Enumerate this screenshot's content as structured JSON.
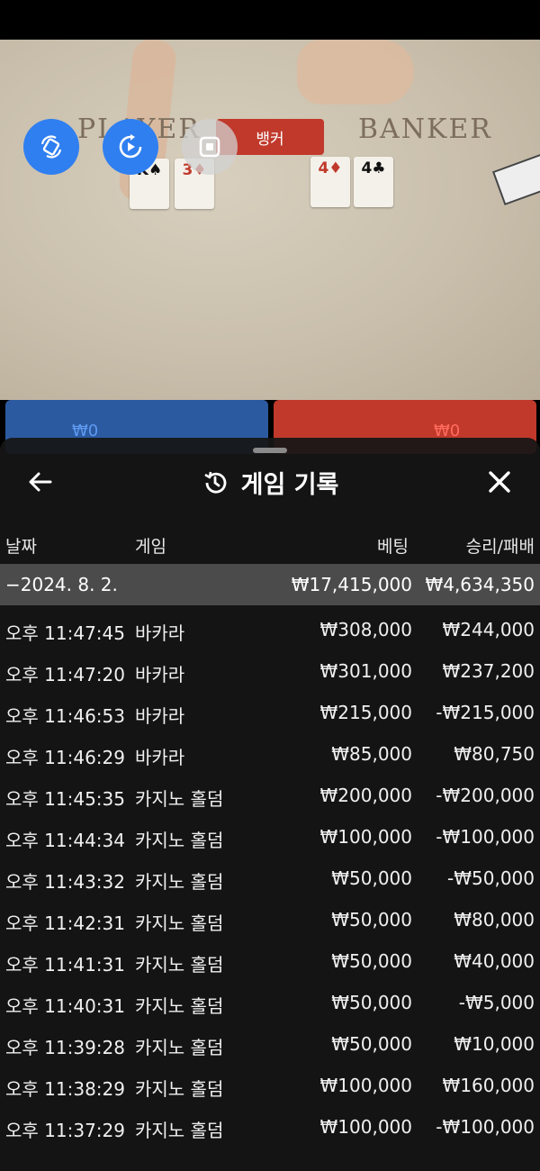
{
  "video": {
    "table_left": "PLAYER",
    "table_right": "BANKER",
    "result_label": "뱅커",
    "player_cards": [
      {
        "rank": "K",
        "suit": "♠",
        "color": "black"
      },
      {
        "rank": "3",
        "suit": "♦",
        "color": "red"
      }
    ],
    "banker_cards": [
      {
        "rank": "4",
        "suit": "♦",
        "color": "red"
      },
      {
        "rank": "4",
        "suit": "♣",
        "color": "black"
      }
    ],
    "player_bet": "₩0",
    "banker_bet": "₩0",
    "controls": [
      {
        "icon": "rotate-icon"
      },
      {
        "icon": "replay-icon"
      },
      {
        "icon": "stop-icon"
      }
    ]
  },
  "sheet": {
    "title": "게임 기록",
    "columns": {
      "date": "날짜",
      "game": "게임",
      "bet": "베팅",
      "result": "승리/패배"
    },
    "summary": {
      "date": "−2024. 8. 2.",
      "bet": "₩17,415,000",
      "result": "₩4,634,350"
    },
    "rows": [
      {
        "time": "오후 11:47:45",
        "game": "바카라",
        "bet": "₩308,000",
        "result": "₩244,000"
      },
      {
        "time": "오후 11:47:20",
        "game": "바카라",
        "bet": "₩301,000",
        "result": "₩237,200"
      },
      {
        "time": "오후 11:46:53",
        "game": "바카라",
        "bet": "₩215,000",
        "result": "-₩215,000"
      },
      {
        "time": "오후 11:46:29",
        "game": "바카라",
        "bet": "₩85,000",
        "result": "₩80,750"
      },
      {
        "time": "오후 11:45:35",
        "game": "카지노 홀덤",
        "bet": "₩200,000",
        "result": "-₩200,000"
      },
      {
        "time": "오후 11:44:34",
        "game": "카지노 홀덤",
        "bet": "₩100,000",
        "result": "-₩100,000"
      },
      {
        "time": "오후 11:43:32",
        "game": "카지노 홀덤",
        "bet": "₩50,000",
        "result": "-₩50,000"
      },
      {
        "time": "오후 11:42:31",
        "game": "카지노 홀덤",
        "bet": "₩50,000",
        "result": "₩80,000"
      },
      {
        "time": "오후 11:41:31",
        "game": "카지노 홀덤",
        "bet": "₩50,000",
        "result": "₩40,000"
      },
      {
        "time": "오후 11:40:31",
        "game": "카지노 홀덤",
        "bet": "₩50,000",
        "result": "-₩5,000"
      },
      {
        "time": "오후 11:39:28",
        "game": "카지노 홀덤",
        "bet": "₩50,000",
        "result": "₩10,000"
      },
      {
        "time": "오후 11:38:29",
        "game": "카지노 홀덤",
        "bet": "₩100,000",
        "result": "₩160,000"
      },
      {
        "time": "오후 11:37:29",
        "game": "카지노 홀덤",
        "bet": "₩100,000",
        "result": "-₩100,000"
      }
    ]
  }
}
